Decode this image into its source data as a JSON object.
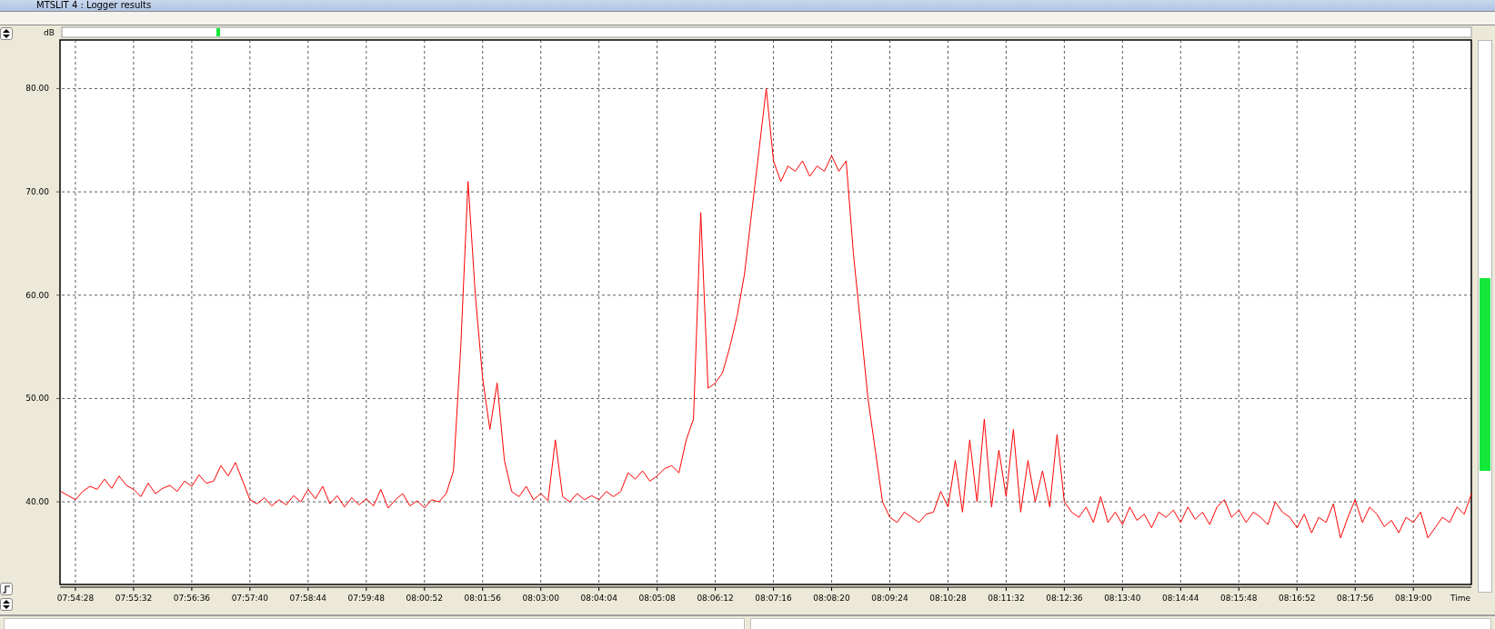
{
  "window": {
    "title": "MTSLIT 4 : Logger results"
  },
  "chart": {
    "chart_data": {
      "type": "line",
      "grid": true,
      "xlabel": "Time",
      "ylabel": "dB",
      "ylim": [
        32,
        84.7
      ],
      "yticks": [
        {
          "value": 40,
          "label": "40.00"
        },
        {
          "value": 50,
          "label": "50.00"
        },
        {
          "value": 60,
          "label": "60.00"
        },
        {
          "value": 70,
          "label": "70.00"
        },
        {
          "value": 80,
          "label": "80.00"
        }
      ],
      "categories": [
        null,
        null,
        "07:54:28",
        null,
        null,
        null,
        null,
        null,
        null,
        null,
        "07:55:32",
        null,
        null,
        null,
        null,
        null,
        null,
        null,
        "07:56:36",
        null,
        null,
        null,
        null,
        null,
        null,
        null,
        "07:57:40",
        null,
        null,
        null,
        null,
        null,
        null,
        null,
        "07:58:44",
        null,
        null,
        null,
        null,
        null,
        null,
        null,
        "07:59:48",
        null,
        null,
        null,
        null,
        null,
        null,
        null,
        "08:00:52",
        null,
        null,
        null,
        null,
        null,
        null,
        null,
        "08:01:56",
        null,
        null,
        null,
        null,
        null,
        null,
        null,
        "08:03:00",
        null,
        null,
        null,
        null,
        null,
        null,
        null,
        "08:04:04",
        null,
        null,
        null,
        null,
        null,
        null,
        null,
        "08:05:08",
        null,
        null,
        null,
        null,
        null,
        null,
        null,
        "08:06:12",
        null,
        null,
        null,
        null,
        null,
        null,
        null,
        "08:07:16",
        null,
        null,
        null,
        null,
        null,
        null,
        null,
        "08:08:20",
        null,
        null,
        null,
        null,
        null,
        null,
        null,
        "08:09:24",
        null,
        null,
        null,
        null,
        null,
        null,
        null,
        "08:10:28",
        null,
        null,
        null,
        null,
        null,
        null,
        null,
        "08:11:32",
        null,
        null,
        null,
        null,
        null,
        null,
        null,
        "08:12:36",
        null,
        null,
        null,
        null,
        null,
        null,
        null,
        "08:13:40",
        null,
        null,
        null,
        null,
        null,
        null,
        null,
        "08:14:44",
        null,
        null,
        null,
        null,
        null,
        null,
        null,
        "08:15:48",
        null,
        null,
        null,
        null,
        null,
        null,
        null,
        "08:16:52",
        null,
        null,
        null,
        null,
        null,
        null,
        null,
        "08:17:56",
        null,
        null,
        null,
        null,
        null,
        null,
        null,
        "08:19:00",
        null,
        null,
        null,
        null,
        null,
        null,
        null,
        null
      ],
      "series": [
        {
          "color": "#ff0000",
          "values": [
            41.0,
            40.6,
            40.2,
            41.0,
            41.5,
            41.2,
            42.2,
            41.3,
            42.5,
            41.6,
            41.2,
            40.5,
            41.8,
            40.8,
            41.3,
            41.6,
            41.0,
            42.0,
            41.5,
            42.6,
            41.8,
            42.0,
            43.5,
            42.5,
            43.8,
            42.0,
            40.2,
            39.8,
            40.4,
            39.6,
            40.2,
            39.7,
            40.6,
            40.0,
            41.2,
            40.3,
            41.5,
            39.8,
            40.6,
            39.5,
            40.4,
            39.7,
            40.3,
            39.6,
            41.2,
            39.4,
            40.2,
            40.8,
            39.6,
            40.1,
            39.4,
            40.2,
            40.0,
            40.8,
            43.0,
            55.0,
            71.0,
            60.0,
            52.0,
            47.0,
            51.5,
            44.0,
            41.0,
            40.5,
            41.5,
            40.2,
            40.8,
            40.1,
            46.0,
            40.5,
            40.0,
            40.8,
            40.2,
            40.6,
            40.2,
            41.0,
            40.5,
            41.0,
            42.8,
            42.2,
            43.0,
            42.0,
            42.5,
            43.2,
            43.5,
            42.8,
            46.0,
            48.0,
            68.0,
            51.0,
            51.5,
            52.5,
            55.0,
            58.0,
            62.0,
            68.0,
            74.0,
            80.0,
            73.0,
            71.0,
            72.5,
            72.0,
            73.0,
            71.5,
            72.5,
            72.0,
            73.5,
            72.0,
            73.0,
            64.0,
            57.0,
            50.0,
            45.0,
            40.0,
            38.5,
            38.0,
            39.0,
            38.5,
            38.0,
            38.8,
            39.0,
            41.0,
            39.5,
            44.0,
            39.0,
            46.0,
            40.0,
            48.0,
            39.5,
            45.0,
            40.5,
            47.0,
            39.0,
            44.0,
            40.0,
            43.0,
            39.5,
            46.5,
            40.0,
            39.0,
            38.5,
            39.5,
            38.0,
            40.5,
            38.0,
            39.0,
            37.8,
            39.5,
            38.2,
            38.8,
            37.5,
            39.0,
            38.5,
            39.2,
            38.0,
            39.5,
            38.3,
            39.0,
            37.8,
            39.5,
            40.2,
            38.5,
            39.2,
            38.0,
            39.0,
            38.5,
            37.8,
            40.0,
            39.0,
            38.5,
            37.5,
            38.8,
            37.0,
            38.5,
            38.0,
            39.8,
            36.5,
            38.5,
            40.2,
            38.0,
            39.5,
            38.8,
            37.6,
            38.2,
            37.0,
            38.5,
            38.0,
            39.0,
            36.5,
            37.5,
            38.5,
            38.0,
            39.5,
            38.8,
            40.8
          ]
        }
      ]
    }
  }
}
